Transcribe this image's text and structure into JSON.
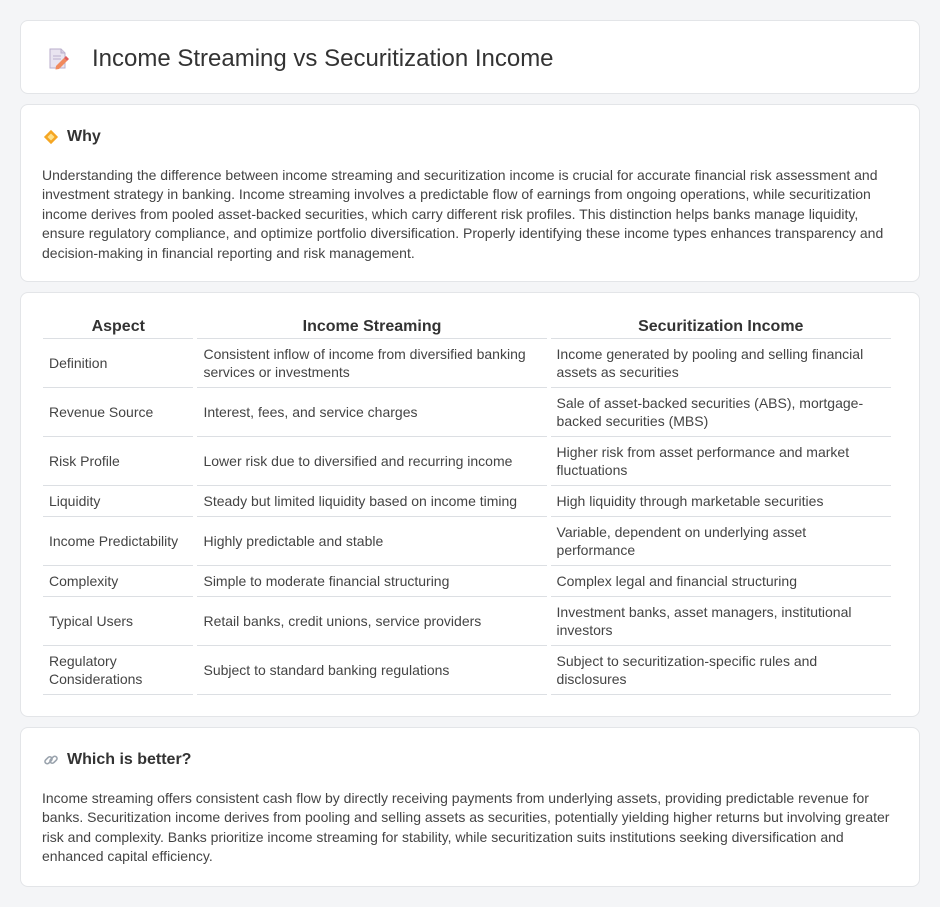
{
  "header": {
    "title": "Income Streaming vs Securitization Income",
    "icon": "document-pencil-icon"
  },
  "why": {
    "heading": "Why",
    "icon": "diamond-sign-icon",
    "text": "Understanding the difference between income streaming and securitization income is crucial for accurate financial risk assessment and investment strategy in banking. Income streaming involves a predictable flow of earnings from ongoing operations, while securitization income derives from pooled asset-backed securities, which carry different risk profiles. This distinction helps banks manage liquidity, ensure regulatory compliance, and optimize portfolio diversification. Properly identifying these income types enhances transparency and decision-making in financial reporting and risk management."
  },
  "table": {
    "headers": [
      "Aspect",
      "Income Streaming",
      "Securitization Income"
    ],
    "rows": [
      [
        "Definition",
        "Consistent inflow of income from diversified banking services or investments",
        "Income generated by pooling and selling financial assets as securities"
      ],
      [
        "Revenue Source",
        "Interest, fees, and service charges",
        "Sale of asset-backed securities (ABS), mortgage-backed securities (MBS)"
      ],
      [
        "Risk Profile",
        "Lower risk due to diversified and recurring income",
        "Higher risk from asset performance and market fluctuations"
      ],
      [
        "Liquidity",
        "Steady but limited liquidity based on income timing",
        "High liquidity through marketable securities"
      ],
      [
        "Income Predictability",
        "Highly predictable and stable",
        "Variable, dependent on underlying asset performance"
      ],
      [
        "Complexity",
        "Simple to moderate financial structuring",
        "Complex legal and financial structuring"
      ],
      [
        "Typical Users",
        "Retail banks, credit unions, service providers",
        "Investment banks, asset managers, institutional investors"
      ],
      [
        "Regulatory Considerations",
        "Subject to standard banking regulations",
        "Subject to securitization-specific rules and disclosures"
      ]
    ]
  },
  "better": {
    "heading": "Which is better?",
    "icon": "link-icon",
    "text": "Income streaming offers consistent cash flow by directly receiving payments from underlying assets, providing predictable revenue for banks. Securitization income derives from pooling and selling assets as securities, potentially yielding higher returns but involving greater risk and complexity. Banks prioritize income streaming for stability, while securitization suits institutions seeking diversification and enhanced capital efficiency."
  }
}
